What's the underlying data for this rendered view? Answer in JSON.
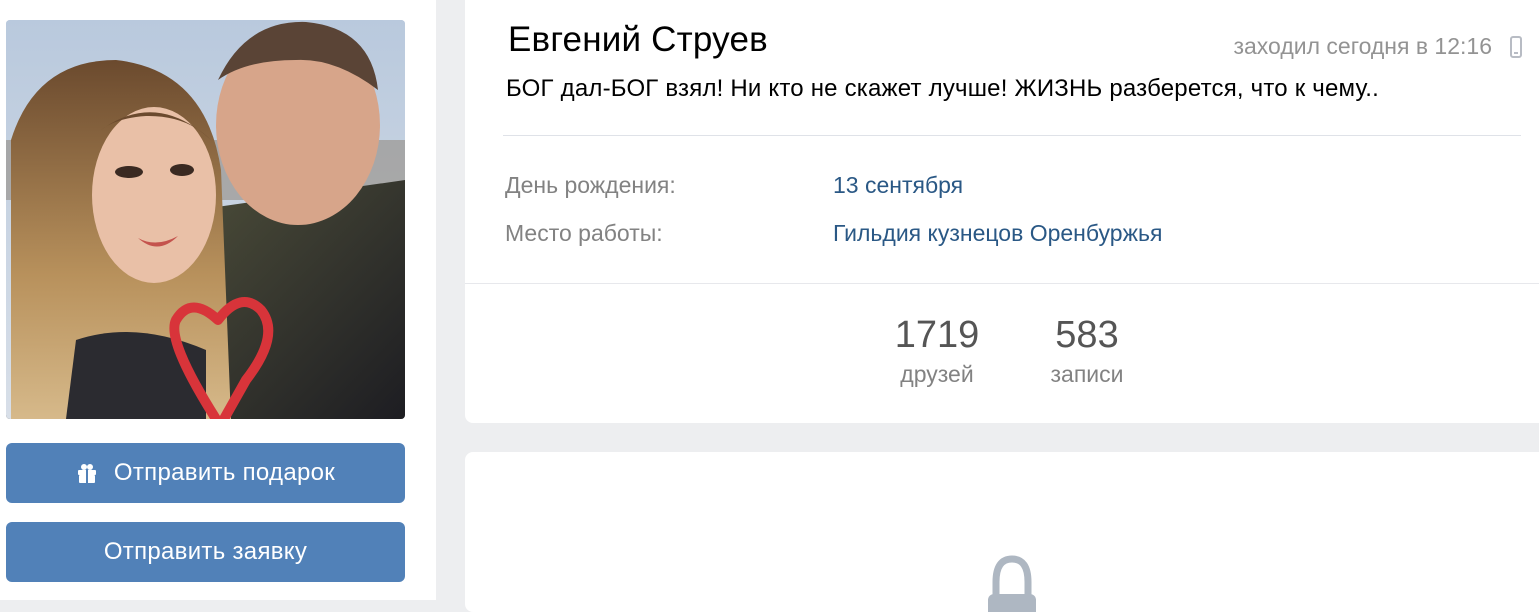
{
  "profile": {
    "name": "Евгений Струев",
    "last_seen": "заходил сегодня в 12:16",
    "status": "БОГ дал-БОГ взял! Ни кто не скажет лучше! ЖИЗНЬ разберется, что к чему..",
    "info": [
      {
        "label": "День рождения:",
        "value": "13 сентября"
      },
      {
        "label": "Место работы:",
        "value": "Гильдия кузнецов Оренбуржья"
      }
    ],
    "counters": [
      {
        "value": "1719",
        "label": "друзей"
      },
      {
        "value": "583",
        "label": "записи"
      }
    ]
  },
  "actions": {
    "send_gift": "Отправить подарок",
    "send_request": "Отправить заявку"
  },
  "icons": {
    "gift": "gift-icon",
    "device": "mobile-phone-icon",
    "lock": "lock-icon"
  },
  "colors": {
    "button": "#5181b8",
    "link": "#2a5885",
    "muted": "#828282",
    "background": "#edeef0"
  }
}
